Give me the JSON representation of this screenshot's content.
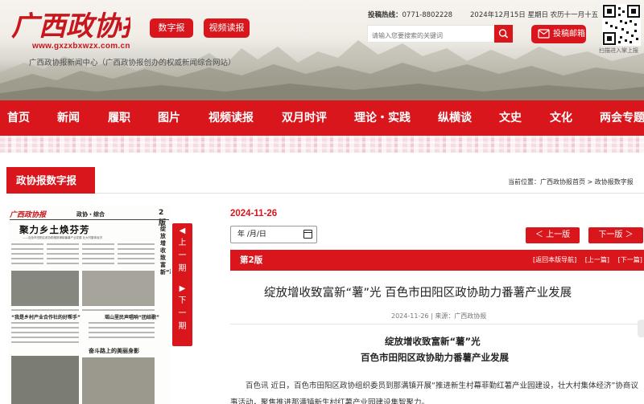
{
  "header": {
    "logo_text": "广西政协报",
    "site_url": "www.gxzxbxwzx.com.cn",
    "site_desc": "广西政协报新闻中心（广西政协报创办的权威新闻综合网站）",
    "digital_label": "数字报",
    "video_label": "视频读报",
    "hotline_label": "投稿热线：",
    "hotline_number": "0771-8802228",
    "date_text": "2024年12月15日 星期日 农历十一月十五",
    "search_placeholder": "请输入您要搜索的关键词",
    "mail_label": "投稿邮箱",
    "qr_caption": "扫描进入掌上报"
  },
  "nav": {
    "items": [
      "首页",
      "新闻",
      "履职",
      "图片",
      "视频读报",
      "双月时评",
      "理论・实践",
      "纵横谈",
      "文史",
      "文化",
      "两会专题"
    ]
  },
  "section": {
    "title": "政协报数字报",
    "breadcrumb": "当前位置：广西政协报首页 > 政协报数字报"
  },
  "paper": {
    "masthead": "广西政协报",
    "section_name": "政协・综合",
    "page_no": "2版",
    "headline": "聚力乡土焕芬芳",
    "subhead": "——百色市田阳区政协助推那满镇番薯产业发展 壮大村集体经济",
    "story2": "“我是乡村产业合作社的好帮手”",
    "story3": "瑶山里民声唱响“团结歌”",
    "story4": "奋斗路上的美丽身影",
    "vertical_title": "绽放增收致富新“薯”光",
    "arrow_prev_label": "上一期",
    "arrow_next_label": "下一期"
  },
  "issue": {
    "date": "2024-11-26",
    "date_picker_value": "年 /月/日",
    "prev_edition": "＜ 上一版",
    "next_edition": "下一版 ＞",
    "page_label": "第2版",
    "links": [
      "[返回本版导航]",
      "[上一篇]",
      "[下一篇]"
    ]
  },
  "article": {
    "title": "绽放增收致富新“薯”光 百色市田阳区政协助力番薯产业发展",
    "meta": "2024-11-26 | 来源：广西政协报",
    "sub_headline_1": "绽放增收致富新“薯”光",
    "sub_headline_2": "百色市田阳区政协助力番薯产业发展",
    "body": "百色讯 近日，百色市田阳区政协组织委员到那满镇开展“推进新生村幕菲勤红薯产业园建设，壮大村集体经济”协商议事活动，聚焦推进那满镇新生村红薯产业园建设集智聚力。"
  },
  "colors": {
    "brand_red": "#d8161c"
  }
}
